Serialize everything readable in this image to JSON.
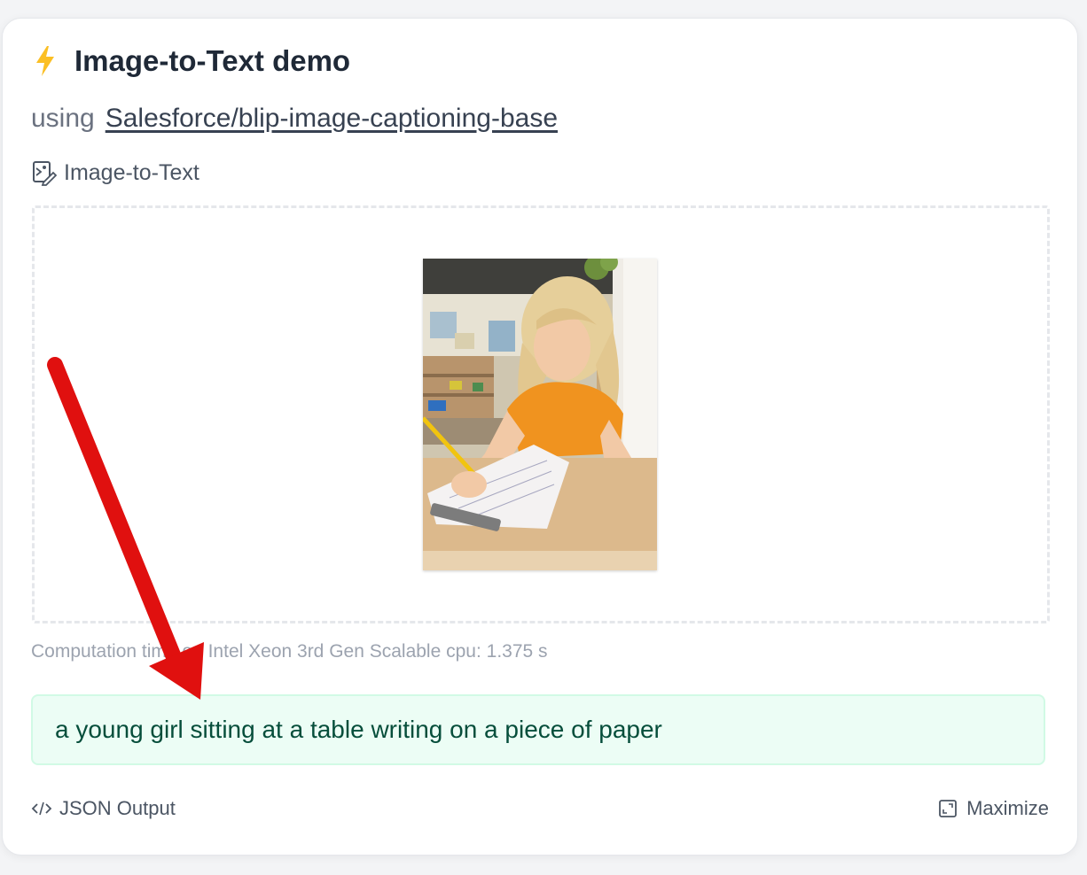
{
  "header": {
    "icon": "lightning-bolt-icon",
    "title": "Image-to-Text demo",
    "using_prefix": "using",
    "model_link": "Salesforce/blip-image-captioning-base"
  },
  "task": {
    "icon": "image-to-text-icon",
    "label": "Image-to-Text"
  },
  "image": {
    "description_icon": "photo-of-girl-writing"
  },
  "computation_time": "Computation time on Intel Xeon 3rd Gen Scalable cpu: 1.375 s",
  "output_text": "a young girl sitting at a table writing on a piece of paper",
  "footer": {
    "json_label": "JSON Output",
    "json_icon": "code-icon",
    "maximize_label": "Maximize",
    "maximize_icon": "maximize-icon"
  },
  "colors": {
    "accent_bolt": "#fbbf24",
    "output_bg": "#ecfdf5",
    "output_text": "#064e3b",
    "annotation_arrow": "#e0100f"
  }
}
